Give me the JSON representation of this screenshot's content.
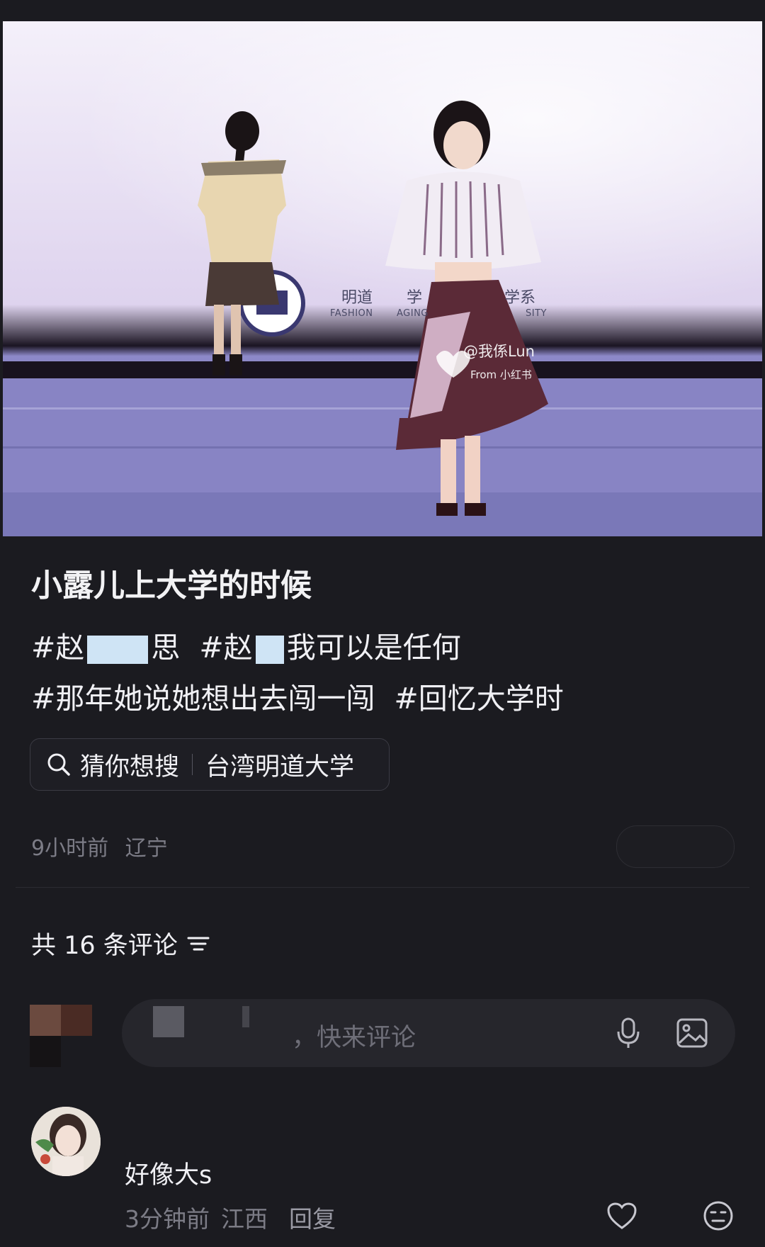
{
  "post": {
    "title": "小露儿上大学的时候",
    "tags": [
      {
        "parts": [
          "#赵",
          "思"
        ]
      },
      {
        "parts": [
          "#赵",
          "我可以是任何"
        ]
      },
      {
        "parts": [
          "#那年她说她想出去闯一闯"
        ]
      },
      {
        "parts": [
          "#回忆大学时"
        ]
      }
    ],
    "media": {
      "watermark_handle": "@我係Lun",
      "watermark_source": "From 小红书",
      "stage_sign_left": "明道",
      "stage_sign_mid": "学",
      "stage_sign_right": "学系",
      "stage_sign_en_left": "FASHION",
      "stage_sign_en_mid": "AGING",
      "stage_sign_en_right": "SITY"
    }
  },
  "search_suggest": {
    "label": "猜你想搜",
    "query": "台湾明道大学",
    "icon": "search-icon"
  },
  "meta": {
    "time": "9小时前",
    "location": "辽宁"
  },
  "comments": {
    "header": "共 16 条评论",
    "sort_icon": "sort-icon",
    "input_placeholder": "，快来评论",
    "items": [
      {
        "text": "好像大s",
        "time": "3分钟前",
        "location": "江西",
        "reply_label": "回复"
      }
    ]
  },
  "colors": {
    "background": "#1b1b20",
    "text_primary": "#f0f0f4",
    "text_secondary": "#7c7c86",
    "input_bg": "#26262c"
  }
}
